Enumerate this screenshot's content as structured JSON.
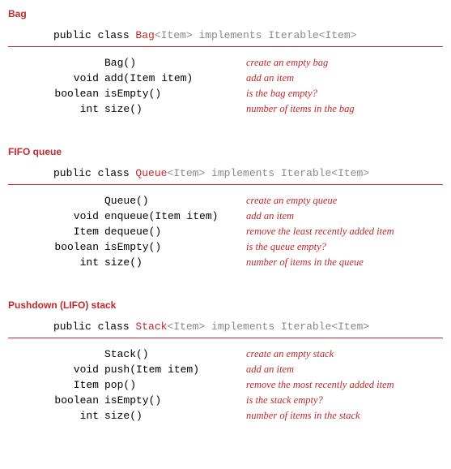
{
  "sections": [
    {
      "title": "Bag",
      "decl": {
        "prefix": "public class ",
        "name": "Bag",
        "generic": "<Item>",
        "impl": " implements Iterable<Item>"
      },
      "methods": [
        {
          "ret": "",
          "sig": "Bag()",
          "desc": "create an empty bag"
        },
        {
          "ret": "void",
          "sig": "add(Item item)",
          "desc": "add an item"
        },
        {
          "ret": "boolean",
          "sig": "isEmpty()",
          "desc": "is the bag empty?"
        },
        {
          "ret": "int",
          "sig": "size()",
          "desc": "number of items in the bag"
        }
      ]
    },
    {
      "title": "FIFO queue",
      "decl": {
        "prefix": "public class ",
        "name": "Queue",
        "generic": "<Item>",
        "impl": " implements Iterable<Item>"
      },
      "methods": [
        {
          "ret": "",
          "sig": "Queue()",
          "desc": "create an empty queue"
        },
        {
          "ret": "void",
          "sig": "enqueue(Item item)",
          "desc": "add an item"
        },
        {
          "ret": "Item",
          "sig": "dequeue()",
          "desc": "remove the least recently added item"
        },
        {
          "ret": "boolean",
          "sig": "isEmpty()",
          "desc": "is the queue empty?"
        },
        {
          "ret": "int",
          "sig": "size()",
          "desc": "number of items in the queue"
        }
      ]
    },
    {
      "title": "Pushdown (LIFO) stack",
      "decl": {
        "prefix": "public class ",
        "name": "Stack",
        "generic": "<Item>",
        "impl": " implements Iterable<Item>"
      },
      "methods": [
        {
          "ret": "",
          "sig": "Stack()",
          "desc": "create an empty stack"
        },
        {
          "ret": "void",
          "sig": "push(Item item)",
          "desc": "add an item"
        },
        {
          "ret": "Item",
          "sig": "pop()",
          "desc": "remove the most recently added item"
        },
        {
          "ret": "boolean",
          "sig": "isEmpty()",
          "desc": "is the stack empty?"
        },
        {
          "ret": "int",
          "sig": "size()",
          "desc": "number of items in the stack"
        }
      ]
    }
  ]
}
